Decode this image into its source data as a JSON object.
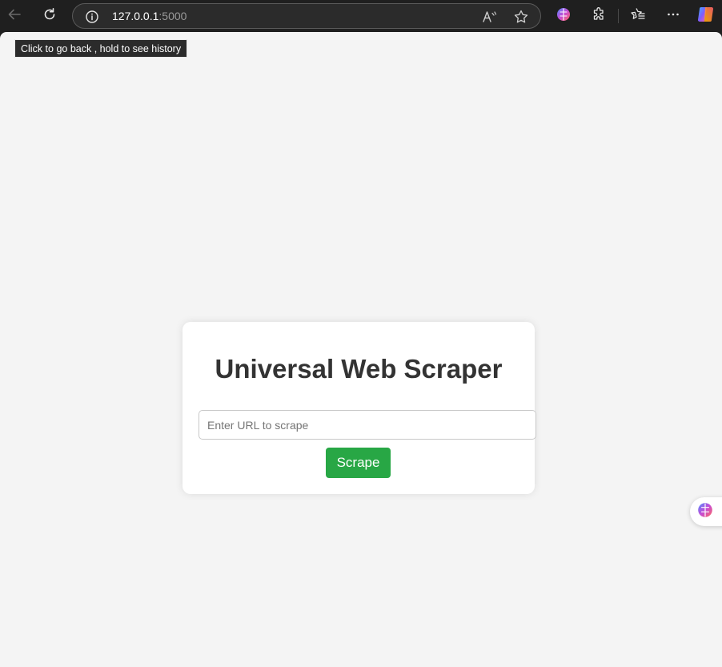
{
  "browser": {
    "address": {
      "host": "127.0.0.1",
      "port": ":5000"
    },
    "tooltip": "Click to go back , hold to see history",
    "icons": {
      "back": "back-arrow-icon",
      "refresh": "refresh-icon",
      "site_info": "info-icon",
      "read_aloud": "read-aloud-icon",
      "favorite": "star-icon",
      "copilot_brain": "brain-icon",
      "extensions": "puzzle-icon",
      "favorites_list": "favorites-icon",
      "menu": "more-icon",
      "copilot": "copilot-icon"
    }
  },
  "page": {
    "title": "Universal Web Scraper",
    "url_input": {
      "placeholder": "Enter URL to scrape",
      "value": ""
    },
    "submit_label": "Scrape"
  },
  "colors": {
    "accent_button": "#28a745",
    "page_background": "#f4f4f4",
    "browser_chrome": "#1f1f1f"
  }
}
